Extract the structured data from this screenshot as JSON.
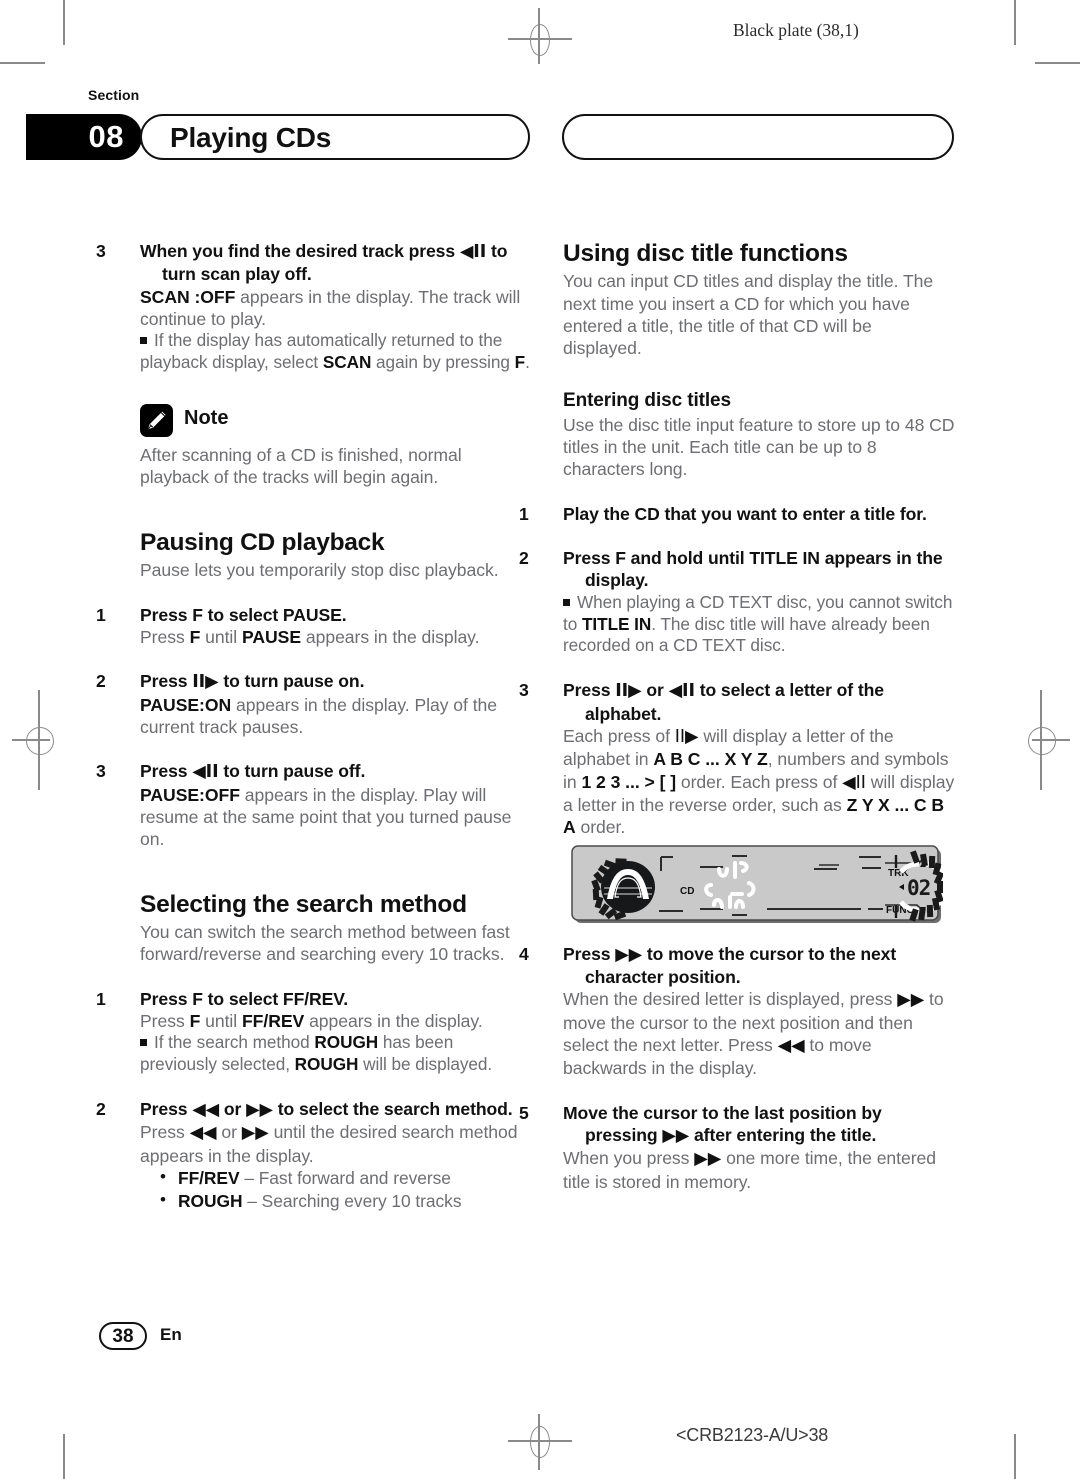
{
  "page": {
    "black_plate": "Black plate (38,1)",
    "page_number": "38",
    "language_code": "En",
    "doc_code": "<CRB2123-A/U>38"
  },
  "header": {
    "section_word": "Section",
    "section_number": "08",
    "title": "Playing CDs",
    "second_pill_title": ""
  },
  "left_column": {
    "step3": {
      "num": "3",
      "text_before": "When you find the desired track press",
      "glyph": "◀II",
      "text_after": "to turn scan play off."
    },
    "step3_body_a": "SCAN :OFF",
    "step3_body_b": " appears in the display. The track will continue to play.",
    "step3_note_a": "If the display has automatically returned to the playback display, select ",
    "step3_note_b": "SCAN",
    "step3_note_c": " again by pressing ",
    "step3_note_d": "F",
    "step3_note_e": ".",
    "note": {
      "icon": "pencil-icon",
      "label": "Note",
      "text": "After scanning of a CD is finished, normal playback of the tracks will begin again."
    },
    "pausing": {
      "heading": "Pausing CD playback",
      "intro": "Pause lets you temporarily stop disc playback.",
      "step1": {
        "num": "1",
        "text": "Press F to select PAUSE."
      },
      "step1_body_a": "Press ",
      "step1_body_b": "F",
      "step1_body_c": " until ",
      "step1_body_d": "PAUSE",
      "step1_body_e": " appears in the display.",
      "step2": {
        "num": "2",
        "text_before": "Press",
        "glyph": "II▶",
        "text_after": "to turn pause on."
      },
      "step2_body_a": "PAUSE:ON",
      "step2_body_b": " appears in the display. Play of the current track pauses.",
      "step3": {
        "num": "3",
        "text_before": "Press",
        "glyph": "◀II",
        "text_after": "to turn pause off."
      },
      "step3_body_a": "PAUSE:OFF",
      "step3_body_b": " appears in the display. Play will resume at the same point that you turned pause on."
    },
    "search": {
      "heading": "Selecting the search method",
      "intro": "You can switch the search method between fast forward/reverse and searching every 10 tracks.",
      "step1": {
        "num": "1",
        "text": "Press F to select FF/REV."
      },
      "step1_body_a": "Press ",
      "step1_body_b": "F",
      "step1_body_c": " until ",
      "step1_body_d": "FF/REV",
      "step1_body_e": " appears in the display.",
      "step1_note_a": "If the search method ",
      "step1_note_b": "ROUGH",
      "step1_note_c": " has been previously selected, ",
      "step1_note_d": "ROUGH",
      "step1_note_e": " will be displayed.",
      "step2": {
        "num": "2",
        "text_before": "Press",
        "glyph1": "◀◀",
        "mid": "or",
        "glyph2": "▶▶",
        "text_after": "to select the search method."
      },
      "step2_body_a": "Press ",
      "step2_body_g1": "◀◀",
      "step2_body_b": " or ",
      "step2_body_g2": "▶▶",
      "step2_body_c": " until the desired search method appears in the display.",
      "options": [
        {
          "label": "FF/REV",
          "desc": " – Fast forward and reverse"
        },
        {
          "label": "ROUGH",
          "desc": " – Searching every 10 tracks"
        }
      ]
    }
  },
  "right_column": {
    "disc_title": {
      "heading": "Using disc title functions",
      "intro": "You can input CD titles and display the title. The next time you insert a CD for which you have entered a title, the title of that CD will be displayed."
    },
    "entering": {
      "heading": "Entering disc titles",
      "intro": "Use the disc title input feature to store up to 48 CD titles in the unit. Each title can be up to 8 characters long.",
      "step1": {
        "num": "1",
        "text": "Play the CD that you want to enter a title for."
      },
      "step2": {
        "num": "2",
        "text": "Press F and hold until TITLE IN appears in the display."
      },
      "step2_note_a": "When playing a CD TEXT disc, you cannot switch to ",
      "step2_note_b": "TITLE IN",
      "step2_note_c": ". The disc title will have already been recorded on a CD TEXT disc.",
      "step3": {
        "num": "3",
        "text_before": "Press",
        "glyph1": "II▶",
        "mid": "or",
        "glyph2": "◀II",
        "text_after": "to select a letter of the alphabet."
      },
      "step3_body_a": "Each press of ",
      "step3_body_g1": "II▶",
      "step3_body_b": " will display a letter of the alphabet in ",
      "step3_body_c": "A B C ... X Y Z",
      "step3_body_d": ", numbers and symbols in ",
      "step3_body_e": "1 2 3 ... > [ ]",
      "step3_body_f": " order. Each press of ",
      "step3_body_g2": "◀II",
      "step3_body_g": " will display a letter in the reverse order, such as ",
      "step3_body_h": "Z Y X ... C B A",
      "step3_body_i": " order.",
      "step4": {
        "num": "4",
        "text_before": "Press",
        "glyph": "▶▶",
        "text_after": "to move the cursor to the next character position."
      },
      "step4_body_a": "When the desired letter is displayed, press ",
      "step4_body_g1": "▶▶",
      "step4_body_b": " to move the cursor to the next position and then select the next letter. Press ",
      "step4_body_g2": "◀◀",
      "step4_body_c": " to move backwards in the display.",
      "step5": {
        "num": "5",
        "text_before": "Move the cursor to the last position by pressing",
        "glyph": "▶▶",
        "text_after": "after entering the title."
      },
      "step5_body_a": "When you press ",
      "step5_body_g1": "▶▶",
      "step5_body_b": " one more time, the entered title is stored in memory."
    },
    "illustration": {
      "name": "car-stereo-display-illustration",
      "cd_label": "CD",
      "trk_label": "TRK",
      "func_label": "FUNC",
      "track_number": "02",
      "body_color": "#c9c9c9"
    }
  }
}
